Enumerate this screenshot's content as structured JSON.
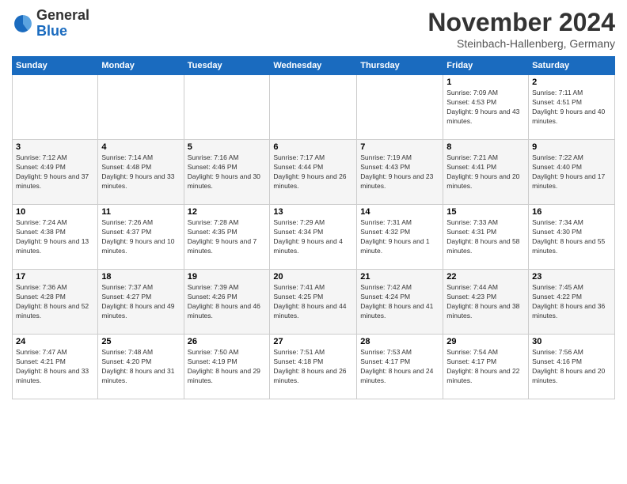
{
  "header": {
    "logo_general": "General",
    "logo_blue": "Blue",
    "month_title": "November 2024",
    "location": "Steinbach-Hallenberg, Germany"
  },
  "days_of_week": [
    "Sunday",
    "Monday",
    "Tuesday",
    "Wednesday",
    "Thursday",
    "Friday",
    "Saturday"
  ],
  "weeks": [
    [
      {
        "day": "",
        "info": ""
      },
      {
        "day": "",
        "info": ""
      },
      {
        "day": "",
        "info": ""
      },
      {
        "day": "",
        "info": ""
      },
      {
        "day": "",
        "info": ""
      },
      {
        "day": "1",
        "info": "Sunrise: 7:09 AM\nSunset: 4:53 PM\nDaylight: 9 hours and 43 minutes."
      },
      {
        "day": "2",
        "info": "Sunrise: 7:11 AM\nSunset: 4:51 PM\nDaylight: 9 hours and 40 minutes."
      }
    ],
    [
      {
        "day": "3",
        "info": "Sunrise: 7:12 AM\nSunset: 4:49 PM\nDaylight: 9 hours and 37 minutes."
      },
      {
        "day": "4",
        "info": "Sunrise: 7:14 AM\nSunset: 4:48 PM\nDaylight: 9 hours and 33 minutes."
      },
      {
        "day": "5",
        "info": "Sunrise: 7:16 AM\nSunset: 4:46 PM\nDaylight: 9 hours and 30 minutes."
      },
      {
        "day": "6",
        "info": "Sunrise: 7:17 AM\nSunset: 4:44 PM\nDaylight: 9 hours and 26 minutes."
      },
      {
        "day": "7",
        "info": "Sunrise: 7:19 AM\nSunset: 4:43 PM\nDaylight: 9 hours and 23 minutes."
      },
      {
        "day": "8",
        "info": "Sunrise: 7:21 AM\nSunset: 4:41 PM\nDaylight: 9 hours and 20 minutes."
      },
      {
        "day": "9",
        "info": "Sunrise: 7:22 AM\nSunset: 4:40 PM\nDaylight: 9 hours and 17 minutes."
      }
    ],
    [
      {
        "day": "10",
        "info": "Sunrise: 7:24 AM\nSunset: 4:38 PM\nDaylight: 9 hours and 13 minutes."
      },
      {
        "day": "11",
        "info": "Sunrise: 7:26 AM\nSunset: 4:37 PM\nDaylight: 9 hours and 10 minutes."
      },
      {
        "day": "12",
        "info": "Sunrise: 7:28 AM\nSunset: 4:35 PM\nDaylight: 9 hours and 7 minutes."
      },
      {
        "day": "13",
        "info": "Sunrise: 7:29 AM\nSunset: 4:34 PM\nDaylight: 9 hours and 4 minutes."
      },
      {
        "day": "14",
        "info": "Sunrise: 7:31 AM\nSunset: 4:32 PM\nDaylight: 9 hours and 1 minute."
      },
      {
        "day": "15",
        "info": "Sunrise: 7:33 AM\nSunset: 4:31 PM\nDaylight: 8 hours and 58 minutes."
      },
      {
        "day": "16",
        "info": "Sunrise: 7:34 AM\nSunset: 4:30 PM\nDaylight: 8 hours and 55 minutes."
      }
    ],
    [
      {
        "day": "17",
        "info": "Sunrise: 7:36 AM\nSunset: 4:28 PM\nDaylight: 8 hours and 52 minutes."
      },
      {
        "day": "18",
        "info": "Sunrise: 7:37 AM\nSunset: 4:27 PM\nDaylight: 8 hours and 49 minutes."
      },
      {
        "day": "19",
        "info": "Sunrise: 7:39 AM\nSunset: 4:26 PM\nDaylight: 8 hours and 46 minutes."
      },
      {
        "day": "20",
        "info": "Sunrise: 7:41 AM\nSunset: 4:25 PM\nDaylight: 8 hours and 44 minutes."
      },
      {
        "day": "21",
        "info": "Sunrise: 7:42 AM\nSunset: 4:24 PM\nDaylight: 8 hours and 41 minutes."
      },
      {
        "day": "22",
        "info": "Sunrise: 7:44 AM\nSunset: 4:23 PM\nDaylight: 8 hours and 38 minutes."
      },
      {
        "day": "23",
        "info": "Sunrise: 7:45 AM\nSunset: 4:22 PM\nDaylight: 8 hours and 36 minutes."
      }
    ],
    [
      {
        "day": "24",
        "info": "Sunrise: 7:47 AM\nSunset: 4:21 PM\nDaylight: 8 hours and 33 minutes."
      },
      {
        "day": "25",
        "info": "Sunrise: 7:48 AM\nSunset: 4:20 PM\nDaylight: 8 hours and 31 minutes."
      },
      {
        "day": "26",
        "info": "Sunrise: 7:50 AM\nSunset: 4:19 PM\nDaylight: 8 hours and 29 minutes."
      },
      {
        "day": "27",
        "info": "Sunrise: 7:51 AM\nSunset: 4:18 PM\nDaylight: 8 hours and 26 minutes."
      },
      {
        "day": "28",
        "info": "Sunrise: 7:53 AM\nSunset: 4:17 PM\nDaylight: 8 hours and 24 minutes."
      },
      {
        "day": "29",
        "info": "Sunrise: 7:54 AM\nSunset: 4:17 PM\nDaylight: 8 hours and 22 minutes."
      },
      {
        "day": "30",
        "info": "Sunrise: 7:56 AM\nSunset: 4:16 PM\nDaylight: 8 hours and 20 minutes."
      }
    ]
  ]
}
